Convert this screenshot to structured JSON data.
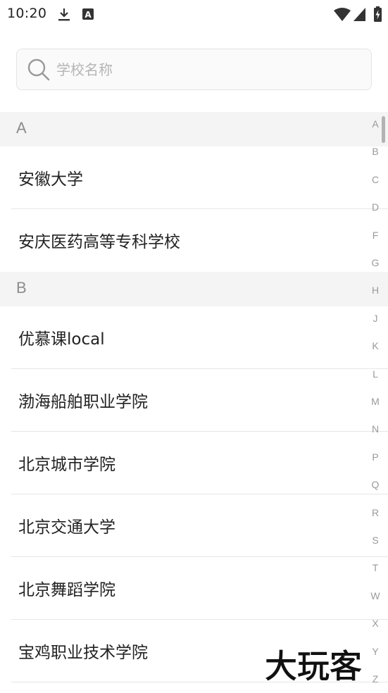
{
  "status_bar": {
    "time": "10:20",
    "icons": [
      "download-icon",
      "notification-a-icon",
      "wifi-icon",
      "signal-icon",
      "battery-charging-icon"
    ]
  },
  "search": {
    "placeholder": "学校名称",
    "value": ""
  },
  "sections": [
    {
      "letter": "A",
      "items": [
        "安徽大学",
        "安庆医药高等专科学校"
      ]
    },
    {
      "letter": "B",
      "items": [
        "优慕课local",
        "渤海船舶职业学院",
        "北京城市学院",
        "北京交通大学",
        "北京舞蹈学院",
        "宝鸡职业技术学院"
      ]
    }
  ],
  "index_letters": [
    "A",
    "B",
    "C",
    "D",
    "F",
    "G",
    "H",
    "J",
    "K",
    "L",
    "M",
    "N",
    "P",
    "Q",
    "R",
    "S",
    "T",
    "W",
    "X",
    "Y",
    "Z"
  ],
  "colors": {
    "section_header_bg": "#f4f4f4",
    "section_header_text": "#8c8c8c",
    "divider": "#e6e6e6",
    "index_text": "#9a9a9a"
  },
  "watermark_text": "大玩客"
}
